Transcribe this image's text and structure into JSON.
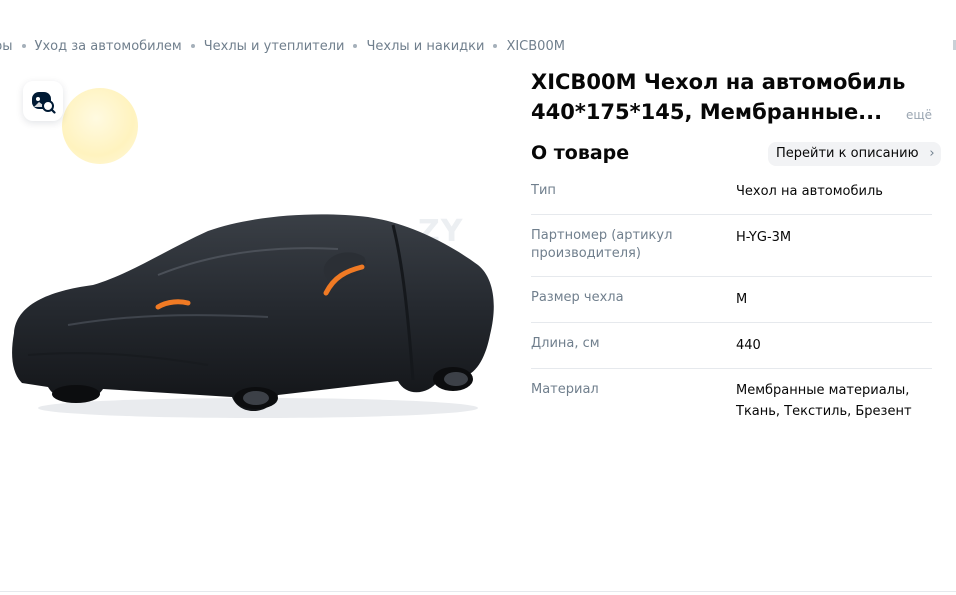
{
  "breadcrumbs": [
    "ры",
    "Уход за автомобилем",
    "Чехлы и утеплители",
    "Чехлы и накидки",
    "XICB00M"
  ],
  "gallery": {
    "search_icon": "search-image-icon",
    "watermark": "ZY"
  },
  "product": {
    "title": "XICB00M Чехол на автомобиль 440*175*145, Мембранные...",
    "more_label": "ещё"
  },
  "about": {
    "title": "О товаре",
    "goto_label": "Перейти к описанию",
    "specs": [
      {
        "key": "Тип",
        "value": "Чехол на автомобиль"
      },
      {
        "key": "Партномер (артикул производителя)",
        "value": "H-YG-3M"
      },
      {
        "key": "Размер чехла",
        "value": "M"
      },
      {
        "key": "Длина, см",
        "value": "440"
      },
      {
        "key": "Материал",
        "value": "Мембранные материалы, Ткань, Текстиль, Брезент"
      }
    ]
  },
  "colors": {
    "accent_orange": "#f07a24",
    "text_primary": "#070707",
    "text_secondary": "#707f8d"
  }
}
